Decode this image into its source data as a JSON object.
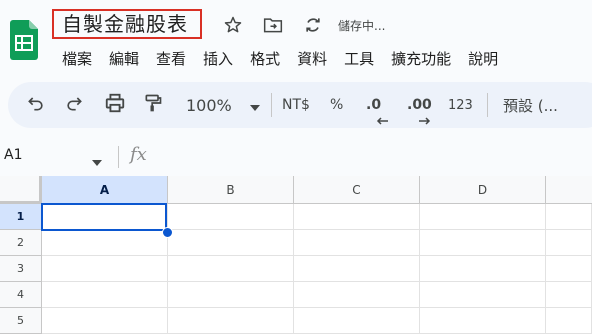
{
  "doc": {
    "title": "自製金融股表",
    "status": "儲存中..."
  },
  "menu": [
    "檔案",
    "編輯",
    "查看",
    "插入",
    "格式",
    "資料",
    "工具",
    "擴充功能",
    "說明"
  ],
  "toolbar": {
    "zoom": "100%",
    "currency": "NT$",
    "percent": "%",
    "decrease_decimal": ".0",
    "increase_decimal": ".00",
    "number_format": "123",
    "font_style": "預設 (..."
  },
  "formula_bar": {
    "name_box": "A1",
    "fx_label": "fx"
  },
  "columns": [
    "A",
    "B",
    "C",
    "D"
  ],
  "rows": [
    "1",
    "2",
    "3",
    "4",
    "5"
  ],
  "colors": {
    "accent": "#0b57d0",
    "title_border": "#d93025",
    "logo_green": "#0f9d58"
  }
}
